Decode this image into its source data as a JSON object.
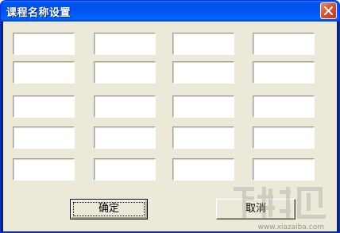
{
  "window": {
    "title": "课程名称设置"
  },
  "fields": {
    "rows": [
      [
        "",
        "",
        "",
        ""
      ],
      [
        "",
        "",
        "",
        ""
      ],
      [
        "",
        "",
        "",
        ""
      ],
      [
        "",
        "",
        "",
        ""
      ],
      [
        "",
        "",
        "",
        ""
      ]
    ]
  },
  "buttons": {
    "ok_label": "确定",
    "cancel_label": "取消"
  },
  "icons": {
    "close": "close-icon"
  },
  "colors": {
    "titlebar": "#0050ee",
    "close_button": "#d8552f",
    "dialog_background": "#ece9d8",
    "field_background": "#ffffff"
  },
  "watermark": {
    "logo_text": "下载吧",
    "site": "www.xiazaiba.com"
  }
}
